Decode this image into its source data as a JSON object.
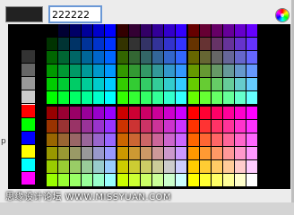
{
  "picker": {
    "current_color": "#222222",
    "hex_value": "222222"
  },
  "palette": {
    "grays": [
      "#000000",
      "#333333",
      "#666666",
      "#999999",
      "#cccccc",
      "#ffffff"
    ],
    "primaries": [
      "#ff0000",
      "#00ff00",
      "#0000ff",
      "#ffff00",
      "#00ffff",
      "#ff00ff"
    ],
    "levels": [
      "00",
      "33",
      "66",
      "99",
      "cc",
      "ff"
    ]
  },
  "side_glyph": "p",
  "watermark": "思缘设计论坛  WWW.MISSYUAN.COM"
}
